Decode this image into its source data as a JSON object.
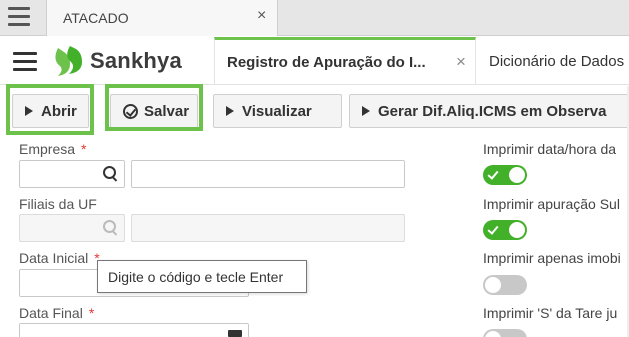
{
  "browser": {
    "tab_title": "ATACADO",
    "close_glyph": "×"
  },
  "header": {
    "brand": "Sankhya",
    "tabs": [
      {
        "label": "Registro de Apuração do I...",
        "close_glyph": "×",
        "active": true
      },
      {
        "label": "Dicionário de Dados"
      }
    ]
  },
  "toolbar": {
    "open_label": "Abrir",
    "save_label": "Salvar",
    "view_label": "Visualizar",
    "generate_label": "Gerar Dif.Aliq.ICMS em Observa"
  },
  "form": {
    "empresa_label": "Empresa",
    "filiais_label": "Filiais da UF",
    "data_inicial_label": "Data Inicial",
    "data_final_label": "Data Final",
    "required_mark": "*",
    "tooltip": "Digite o código e tecle Enter"
  },
  "options": [
    {
      "label": "Imprimir data/hora da",
      "on": true
    },
    {
      "label": "Imprimir apuração Sul",
      "on": true
    },
    {
      "label": "Imprimir apenas imobi",
      "on": false
    },
    {
      "label": "Imprimir 'S' da Tare ju",
      "on": false
    }
  ],
  "colors": {
    "accent": "#6cc24a",
    "toggle_on": "#43b02a",
    "required": "#e53935"
  },
  "icons": [
    "menu-icon",
    "close-icon",
    "sankhya-logo",
    "play-icon",
    "check-circle-icon",
    "search-icon",
    "calendar-icon"
  ]
}
